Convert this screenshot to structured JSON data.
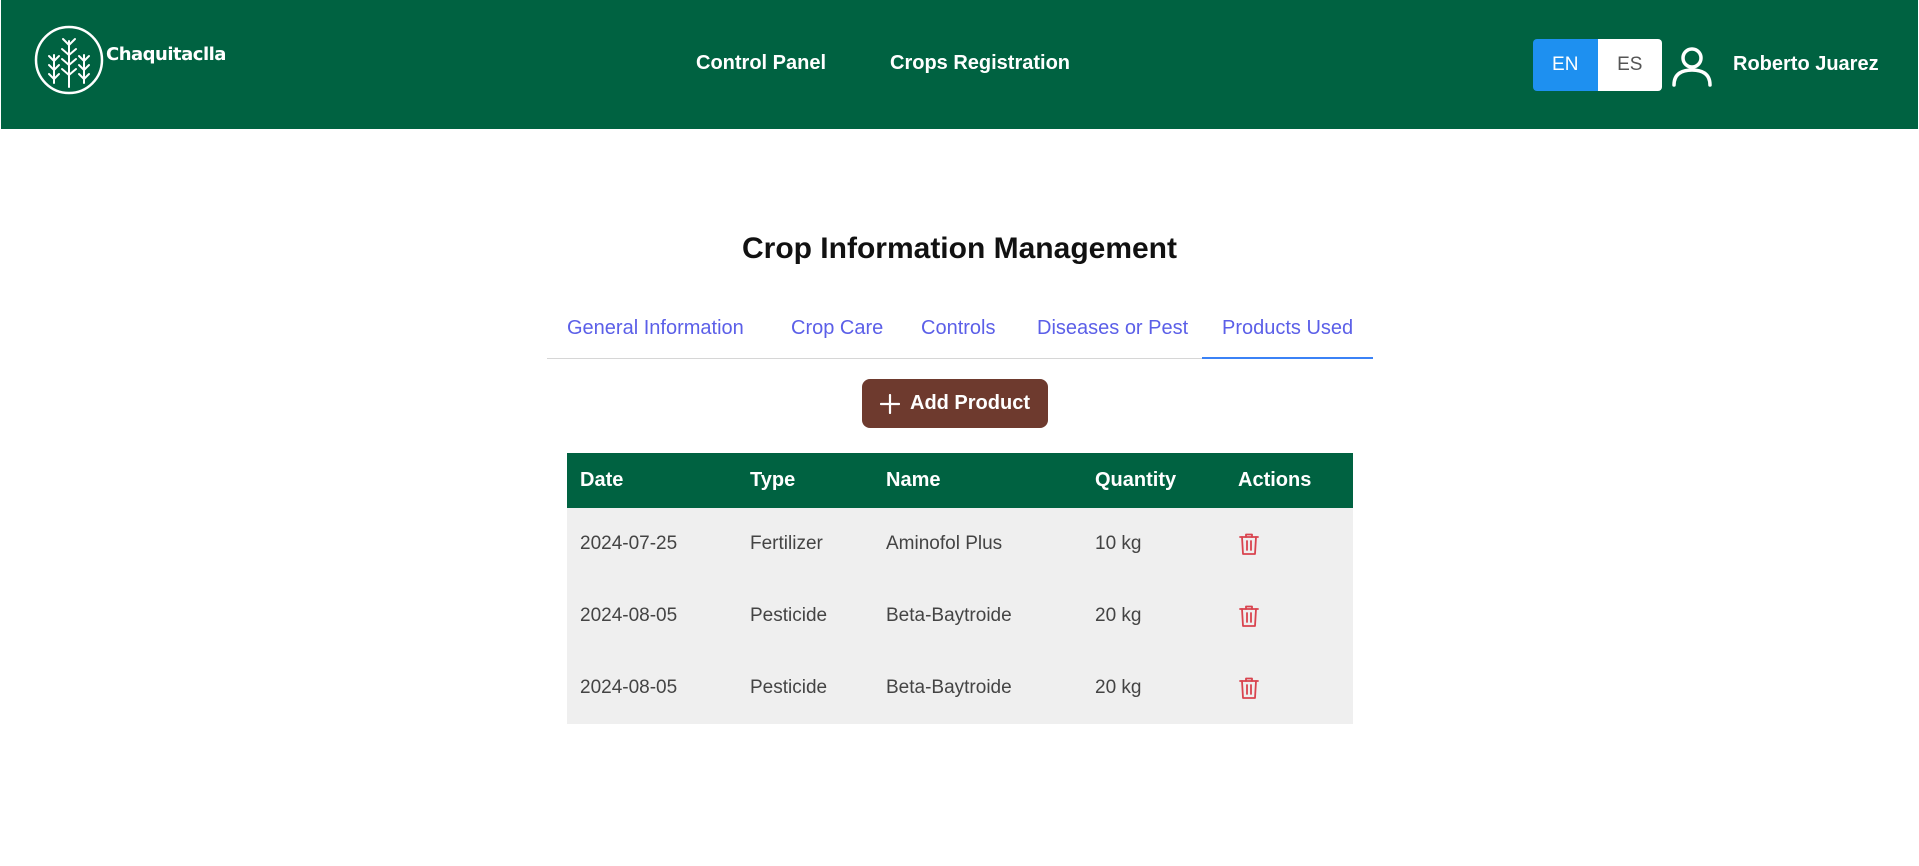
{
  "header": {
    "brand": "Chaquitaclla",
    "nav": [
      {
        "label": "Control Panel"
      },
      {
        "label": "Crops Registration"
      }
    ],
    "languages": [
      {
        "label": "EN",
        "active": true
      },
      {
        "label": "ES",
        "active": false
      }
    ],
    "user_name": "Roberto Juarez"
  },
  "main": {
    "title": "Crop Information Management",
    "tabs": [
      {
        "label": "General Information",
        "active": false
      },
      {
        "label": "Crop Care",
        "active": false
      },
      {
        "label": "Controls",
        "active": false
      },
      {
        "label": "Diseases or Pest",
        "active": false
      },
      {
        "label": "Products Used",
        "active": true
      }
    ],
    "add_button": "Add Product",
    "table": {
      "columns": [
        "Date",
        "Type",
        "Name",
        "Quantity",
        "Actions"
      ],
      "rows": [
        {
          "date": "2024-07-25",
          "type": "Fertilizer",
          "name": "Aminofol Plus",
          "quantity": "10 kg",
          "action_icon": "trash-icon"
        },
        {
          "date": "2024-08-05",
          "type": "Pesticide",
          "name": "Beta-Baytroide",
          "quantity": "20 kg",
          "action_icon": "trash-icon"
        },
        {
          "date": "2024-08-05",
          "type": "Pesticide",
          "name": "Beta-Baytroide",
          "quantity": "20 kg",
          "action_icon": "trash-icon"
        }
      ]
    }
  },
  "colors": {
    "header_bg": "#006241",
    "accent_blue": "#1e90f0",
    "tab_text": "#5b5fe8",
    "add_button_bg": "#6e3a2e",
    "delete_icon": "#d9434e"
  }
}
